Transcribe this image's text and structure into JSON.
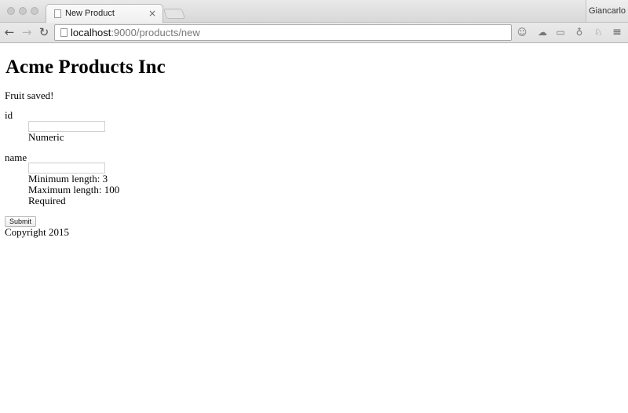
{
  "browser": {
    "tab_title": "New Product",
    "tab_close": "×",
    "profile_name": "Giancarlo",
    "url_host": "localhost",
    "url_path": ":9000/products/new",
    "nav": {
      "back": "←",
      "forward": "→",
      "reload": "↻"
    },
    "extensions": [
      "☺",
      "☁",
      "▭",
      "♁",
      "♘",
      "≡"
    ]
  },
  "page": {
    "title": "Acme Products Inc",
    "flash_message": "Fruit saved!",
    "form": {
      "id": {
        "label": "id",
        "value": "",
        "placeholder": "",
        "hints": [
          "Numeric"
        ]
      },
      "name": {
        "label": "name",
        "value": "",
        "placeholder": "",
        "hints": [
          "Minimum length: 3",
          "Maximum length: 100",
          "Required"
        ]
      },
      "submit_label": "Submit"
    },
    "footer": "Copyright 2015"
  }
}
